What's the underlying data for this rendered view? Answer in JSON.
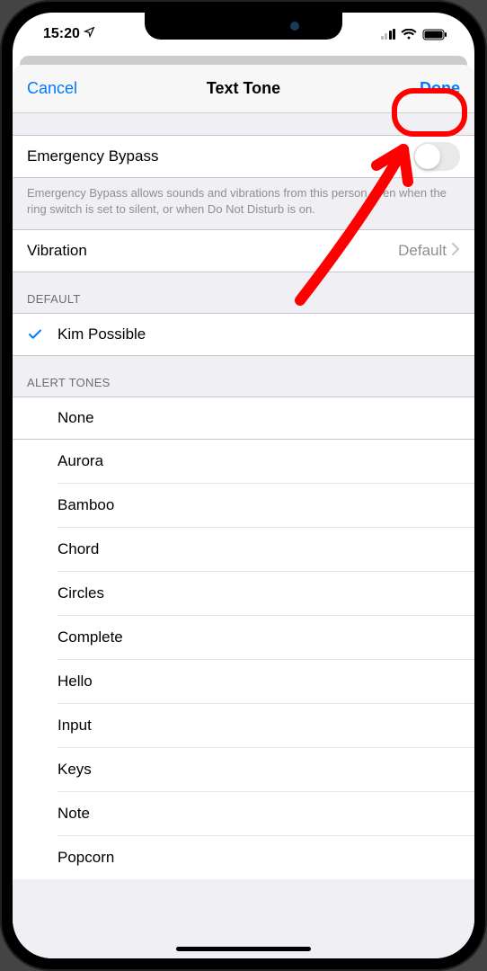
{
  "status": {
    "time": "15:20",
    "location_icon": "location-arrow"
  },
  "nav": {
    "cancel": "Cancel",
    "title": "Text Tone",
    "done": "Done"
  },
  "emergency": {
    "label": "Emergency Bypass",
    "enabled": false,
    "note": "Emergency Bypass allows sounds and vibrations from this person even when the ring switch is set to silent, or when Do Not Disturb is on."
  },
  "vibration": {
    "label": "Vibration",
    "value": "Default"
  },
  "sections": {
    "default_header": "DEFAULT",
    "alert_header": "ALERT TONES"
  },
  "default_tone": {
    "name": "Kim Possible",
    "selected": true
  },
  "alert_tones": [
    {
      "name": "None"
    },
    {
      "name": "Aurora"
    },
    {
      "name": "Bamboo"
    },
    {
      "name": "Chord"
    },
    {
      "name": "Circles"
    },
    {
      "name": "Complete"
    },
    {
      "name": "Hello"
    },
    {
      "name": "Input"
    },
    {
      "name": "Keys"
    },
    {
      "name": "Note"
    },
    {
      "name": "Popcorn"
    }
  ],
  "annotation": {
    "highlight_target": "done-button",
    "arrow_color": "#ff0000"
  }
}
